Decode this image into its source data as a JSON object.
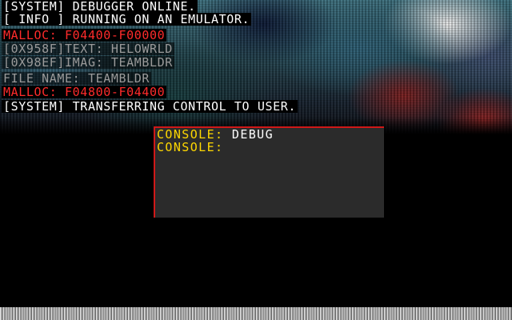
{
  "log": {
    "lines": [
      {
        "text": "[SYSTEM] DEBUGGER ONLINE.",
        "style": "white"
      },
      {
        "text": "[ INFO ] RUNNING ON AN EMULATOR.",
        "style": "white"
      },
      {
        "text": "MALLOC: F04400-F00000",
        "style": "red"
      },
      {
        "text": "[0X958F]TEXT: HELOWRLD",
        "style": "gray"
      },
      {
        "text": "[0X98EF]IMAG: TEAMBLDR",
        "style": "gray"
      },
      {
        "text": "FILE NAME: TEAMBLDR",
        "style": "gray"
      },
      {
        "text": "MALLOC: F04800-F04400",
        "style": "red"
      },
      {
        "text": "[SYSTEM] TRANSFERRING CONTROL TO USER.",
        "style": "white"
      }
    ]
  },
  "console": {
    "line1_key": "CONSOLE:",
    "line1_value": "DEBUG",
    "line2_key": "CONSOLE:",
    "line2_value": ""
  },
  "colors": {
    "text_white": "#ffffff",
    "text_red": "#ff2b2b",
    "text_gray": "#9a9a9a",
    "console_key": "#ffd800",
    "console_bg": "#2b2b2b",
    "console_border": "#d01818",
    "background": "#000000"
  }
}
